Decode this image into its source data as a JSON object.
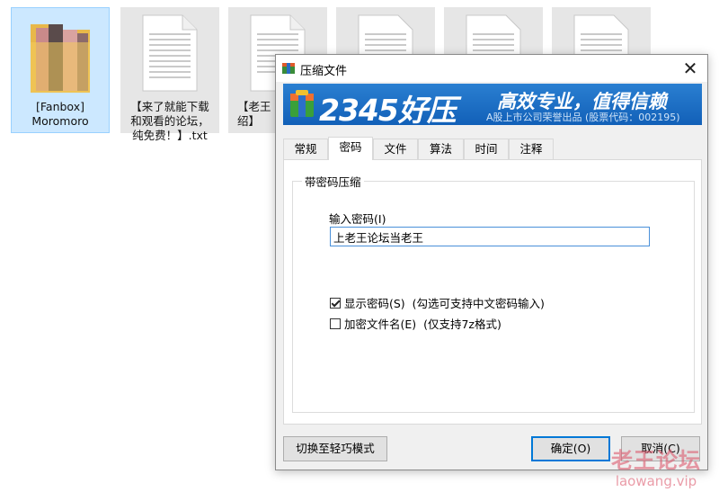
{
  "desktop": {
    "files": [
      {
        "name": "[Fanbox]\nMoromoro",
        "kind": "folder",
        "selected": true
      },
      {
        "name": "【来了就能下载\n和观看的论坛，\n纯免费！】.txt",
        "kind": "txt"
      },
      {
        "name": "【老王\n绍】",
        "kind": "txt"
      },
      {
        "name": "",
        "kind": "txt"
      },
      {
        "name": "",
        "kind": "txt"
      },
      {
        "name": "",
        "kind": "txt"
      }
    ]
  },
  "dialog": {
    "title": "压缩文件",
    "title_icon": "archive-icon",
    "close_glyph": "✕",
    "banner": {
      "brand": "2345好压",
      "slogan": "高效专业，值得信赖",
      "subtitle": "A股上市公司荣誉出品 (股票代码：002195)"
    },
    "tabs": [
      {
        "label": "常规",
        "active": false
      },
      {
        "label": "密码",
        "active": true
      },
      {
        "label": "文件",
        "active": false
      },
      {
        "label": "算法",
        "active": false
      },
      {
        "label": "时间",
        "active": false
      },
      {
        "label": "注释",
        "active": false
      }
    ],
    "password_group": {
      "title": "带密码压缩",
      "input_label": "输入密码(I)",
      "password_value": "上老王论坛当老王",
      "show_password": {
        "label": "显示密码(S)  (勾选可支持中文密码输入)",
        "checked": true
      },
      "encrypt_names": {
        "label": "加密文件名(E)  (仅支持7z格式)",
        "checked": false
      }
    },
    "buttons": {
      "switch_mode": "切换至轻巧模式",
      "ok": "确定(O)",
      "cancel": "取消(C)"
    }
  },
  "watermark": {
    "text": "老王论坛",
    "url": "laowang.vip"
  },
  "colors": {
    "banner_blue": "#1a6cc4",
    "accent": "#0078d7",
    "watermark": "#dc5a6e"
  }
}
